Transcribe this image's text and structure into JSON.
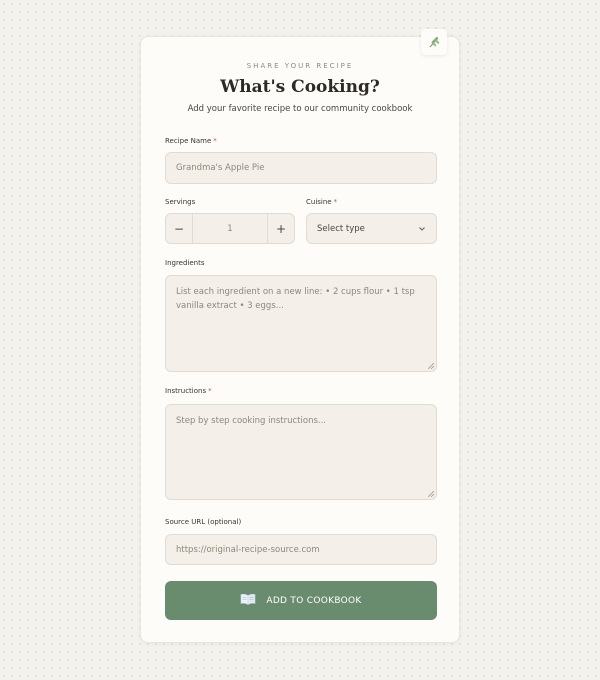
{
  "header": {
    "eyebrow": "SHARE YOUR RECIPE",
    "title": "What's Cooking?",
    "subtitle": "Add your favorite recipe to our community cookbook"
  },
  "form": {
    "recipe_name": {
      "label": "Recipe Name",
      "required_mark": "*",
      "placeholder": "Grandma's Apple Pie"
    },
    "servings": {
      "label": "Servings",
      "value": "1",
      "minus": "−",
      "plus": "+"
    },
    "cuisine": {
      "label": "Cuisine",
      "required_mark": "*",
      "selected": "Select type"
    },
    "ingredients": {
      "label": "Ingredients",
      "placeholder": "List each ingredient on a new line: • 2 cups flour • 1 tsp vanilla extract • 3 eggs..."
    },
    "instructions": {
      "label": "Instructions",
      "required_mark": "*",
      "placeholder": "Step by step cooking instructions..."
    },
    "source_url": {
      "label": "Source URL (optional)",
      "placeholder": "https://original-recipe-source.com"
    }
  },
  "submit": {
    "label": "ADD TO COOKBOOK",
    "icon": "open-book-icon"
  },
  "decor": {
    "icon": "herb-sprig-icon"
  },
  "colors": {
    "accent": "#6a8c6e",
    "required": "#c0564a",
    "field_bg": "#f4efe8",
    "card_bg": "#fdfcf9"
  }
}
